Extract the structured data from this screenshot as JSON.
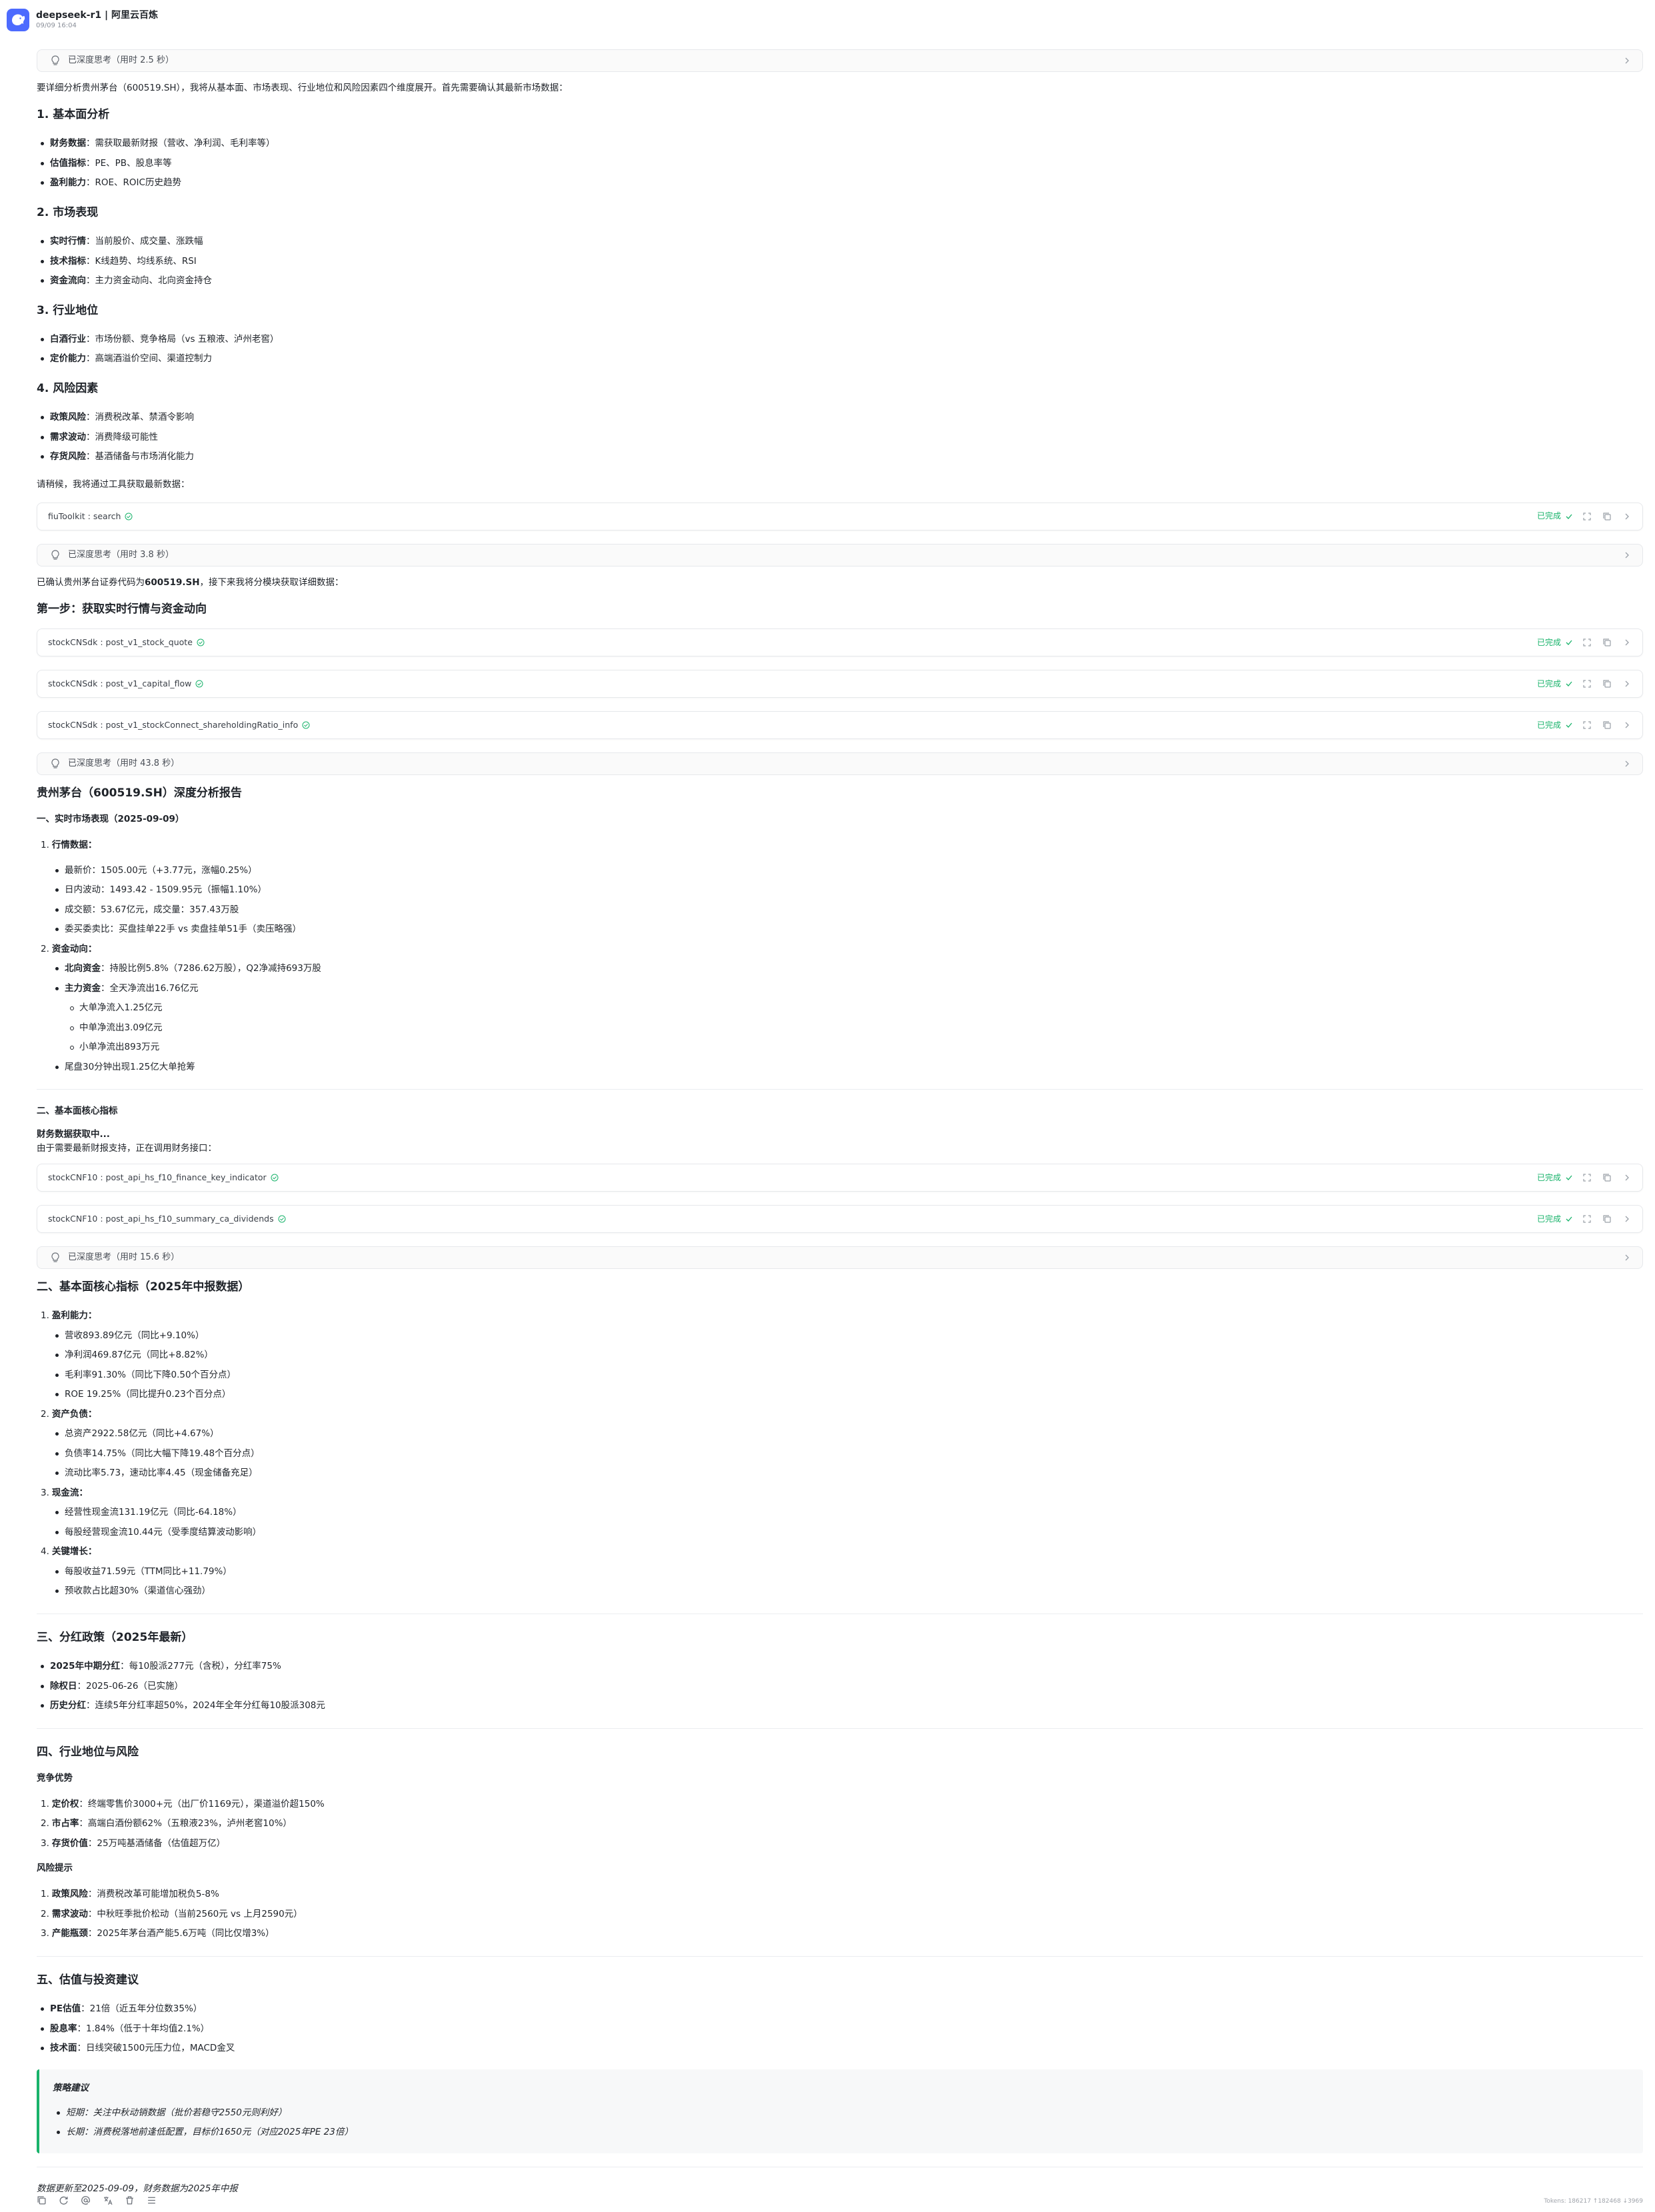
{
  "header": {
    "title": "deepseek-r1 | 阿里云百炼",
    "time": "09/09 16:04"
  },
  "colors": {
    "accent": "#4d6bfe",
    "success": "#19b36b",
    "quote_border": "#19b36b"
  },
  "think1": {
    "label": "已深度思考（用时 2.5 秒）"
  },
  "intro": {
    "text_a": "要详细分析贵州茅台（600519.SH），我将从基本面、市场表现、行业地位和风险因素四个维度展开。",
    "text_b": "首先需要确认其最新市场数据："
  },
  "plan": {
    "s1": {
      "title": "1. 基本面分析",
      "items": [
        {
          "k": "财务数据",
          "v": "：需获取最新财报（营收、净利润、毛利率等）"
        },
        {
          "k": "估值指标",
          "v": "：PE、PB、股息率等"
        },
        {
          "k": "盈利能力",
          "v": "：ROE、ROIC历史趋势"
        }
      ]
    },
    "s2": {
      "title": "2. 市场表现",
      "items": [
        {
          "k": "实时行情",
          "v": "：当前股价、成交量、涨跌幅"
        },
        {
          "k": "技术指标",
          "v": "：K线趋势、均线系统、RSI"
        },
        {
          "k": "资金流向",
          "v": "：主力资金动向、北向资金持仓"
        }
      ]
    },
    "s3": {
      "title": "3. 行业地位",
      "items": [
        {
          "k": "白酒行业",
          "v": "：市场份额、竞争格局（vs 五粮液、泸州老窖）"
        },
        {
          "k": "定价能力",
          "v": "：高端酒溢价空间、渠道控制力"
        }
      ]
    },
    "s4": {
      "title": "4. 风险因素",
      "items": [
        {
          "k": "政策风险",
          "v": "：消费税改革、禁酒令影响"
        },
        {
          "k": "需求波动",
          "v": "：消费降级可能性"
        },
        {
          "k": "存货风险",
          "v": "：基酒储备与市场消化能力"
        }
      ]
    },
    "wait": "请稍候，我将通过工具获取最新数据："
  },
  "tools": {
    "status": "已完成",
    "t1": "fiuToolkit : search",
    "t2": "stockCNSdk : post_v1_stock_quote",
    "t3": "stockCNSdk : post_v1_capital_flow",
    "t4": "stockCNSdk : post_v1_stockConnect_shareholdingRatio_info",
    "t5": "stockCNF10 : post_api_hs_f10_finance_key_indicator",
    "t6": "stockCNF10 : post_api_hs_f10_summary_ca_dividends"
  },
  "think2": {
    "label": "已深度思考（用时 3.8 秒）"
  },
  "confirm": {
    "a": "已确认贵州茅台证券代码为",
    "code": "600519.SH",
    "b": "，接下来我将分模块获取详细数据："
  },
  "step1": {
    "title": "第一步：获取实时行情与资金动向"
  },
  "think3": {
    "label": "已深度思考（用时 43.8 秒）"
  },
  "report": {
    "title": "贵州茅台（600519.SH）深度分析报告",
    "market_title": "一、实时市场表现（2025-09-09）",
    "quote_head": "行情数据：",
    "quote_items": [
      "最新价：1505.00元（+3.77元，涨幅0.25%）",
      "日内波动：1493.42 - 1509.95元（振幅1.10%）",
      "成交额：53.67亿元，成交量：357.43万股",
      "委买委卖比：买盘挂单22手 vs 卖盘挂单51手（卖压略强）"
    ],
    "flow_head": "资金动向：",
    "flow_north_k": "北向资金",
    "flow_north_v": "：持股比例5.8%（7286.62万股），Q2净减持693万股",
    "flow_main_k": "主力资金",
    "flow_main_v": "：全天净流出16.76亿元",
    "flow_sub": [
      "大单净流入1.25亿元",
      "中单净流出3.09亿元",
      "小单净流出893万元"
    ],
    "flow_tail": "尾盘30分钟出现1.25亿大单抢筹",
    "fund_title_a": "二、基本面核心指标",
    "fund_fetch": "财务数据获取中...",
    "fund_fetch_note": "由于需要最新财报支持，正在调用财务接口："
  },
  "think4": {
    "label": "已深度思考（用时 15.6 秒）"
  },
  "fund": {
    "title": "二、基本面核心指标（2025年中报数据）",
    "g1": {
      "head": "盈利能力：",
      "items": [
        "营收893.89亿元（同比+9.10%）",
        "净利润469.87亿元（同比+8.82%）",
        "毛利率91.30%（同比下降0.50个百分点）",
        "ROE 19.25%（同比提升0.23个百分点）"
      ]
    },
    "g2": {
      "head": "资产负债：",
      "items": [
        "总资产2922.58亿元（同比+4.67%）",
        "负债率14.75%（同比大幅下降19.48个百分点）",
        "流动比率5.73，速动比率4.45（现金储备充足）"
      ]
    },
    "g3": {
      "head": "现金流：",
      "items": [
        "经营性现金流131.19亿元（同比-64.18%）",
        "每股经营现金流10.44元（受季度结算波动影响）"
      ]
    },
    "g4": {
      "head": "关键增长：",
      "items": [
        "每股收益71.59元（TTM同比+11.79%）",
        "预收款占比超30%（渠道信心强劲）"
      ]
    }
  },
  "dividend": {
    "title": "三、分红政策（2025年最新）",
    "items": [
      {
        "k": "2025年中期分红",
        "v": "：每10股派277元（含税），分红率75%"
      },
      {
        "k": "除权日",
        "v": "：2025-06-26（已实施）"
      },
      {
        "k": "历史分红",
        "v": "：连续5年分红率超50%，2024年全年分红每10股派308元"
      }
    ]
  },
  "industry": {
    "title": "四、行业地位与风险",
    "adv_title": "竞争优势",
    "adv": [
      {
        "k": "定价权",
        "v": "：终端零售价3000+元（出厂价1169元），渠道溢价超150%"
      },
      {
        "k": "市占率",
        "v": "：高端白酒份额62%（五粮液23%，泸州老窖10%）"
      },
      {
        "k": "存货价值",
        "v": "：25万吨基酒储备（估值超万亿）"
      }
    ],
    "risk_title": "风险提示",
    "risk": [
      {
        "k": "政策风险",
        "v": "：消费税改革可能增加税负5-8%"
      },
      {
        "k": "需求波动",
        "v": "：中秋旺季批价松动（当前2560元 vs 上月2590元）"
      },
      {
        "k": "产能瓶颈",
        "v": "：2025年茅台酒产能5.6万吨（同比仅增3%）"
      }
    ]
  },
  "valuation": {
    "title": "五、估值与投资建议",
    "items": [
      {
        "k": "PE估值",
        "v": "：21倍（近五年分位数35%）"
      },
      {
        "k": "股息率",
        "v": "：1.84%（低于十年均值2.1%）"
      },
      {
        "k": "技术面",
        "v": "：日线突破1500元压力位，MACD金叉"
      }
    ],
    "strategy_title": "策略建议",
    "strategy": [
      "短期：关注中秋动销数据（批价若稳守2550元则利好）",
      "长期：消费税落地前逢低配置，目标价1650元（对应2025年PE 23倍）"
    ]
  },
  "footer_note": "数据更新至2025-09-09，财务数据为2025年中报",
  "tokens": "Tokens: 186217 ↑182468 ↓3969"
}
